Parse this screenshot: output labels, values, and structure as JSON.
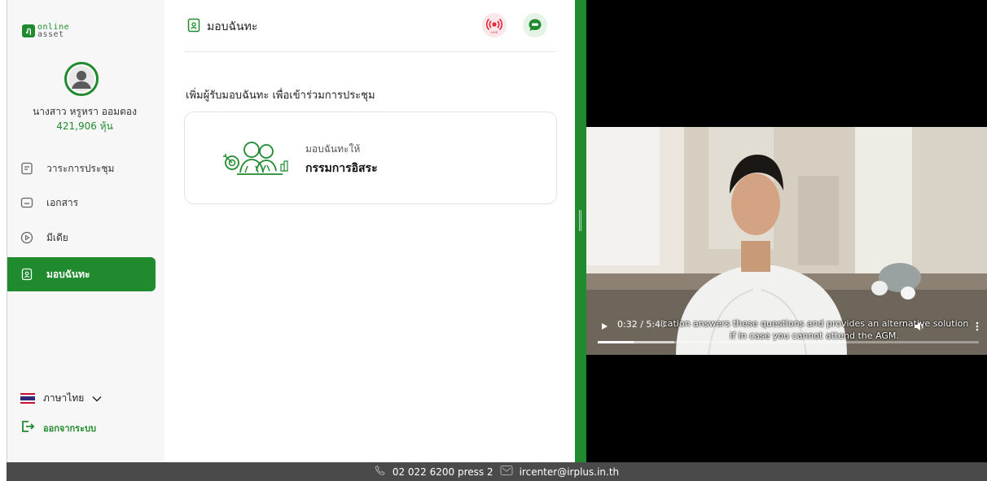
{
  "brand": {
    "logo_line1": "online",
    "logo_line2": "asset"
  },
  "user": {
    "name": "นางสาว หรูหรา ออมตอง",
    "shares": "421,906 หุ้น"
  },
  "sidebar": {
    "items": [
      {
        "label": "วาระการประชุม",
        "icon": "agenda-icon"
      },
      {
        "label": "เอกสาร",
        "icon": "folder-icon"
      },
      {
        "label": "มีเดีย",
        "icon": "play-circle-icon"
      },
      {
        "label": "มอบฉันทะ",
        "icon": "proxy-doc-icon",
        "active": true
      }
    ],
    "language": "ภาษาไทย",
    "logout": "ออกจากระบบ"
  },
  "page": {
    "title": "มอบฉันทะ",
    "section_title": "เพิ่มผู้รับมอบฉันทะ เพื่อเข้าร่วมการประชุม",
    "proxy_card": {
      "subtitle": "มอบฉันทะให้",
      "name": "กรรมการอิสระ"
    }
  },
  "video": {
    "time": "0:32 / 5:40",
    "caption_line1": "ication answers these questions and provides an alternative solution",
    "caption_line2": "if in case you cannot attend the AGM.",
    "progress": 0.094
  },
  "footer": {
    "phone": "02 022 6200 press 2",
    "email": "ircenter@irplus.in.th"
  },
  "colors": {
    "accent": "#1f8a2e",
    "live": "#e3273a",
    "footer_bg": "#4a4a4a"
  }
}
